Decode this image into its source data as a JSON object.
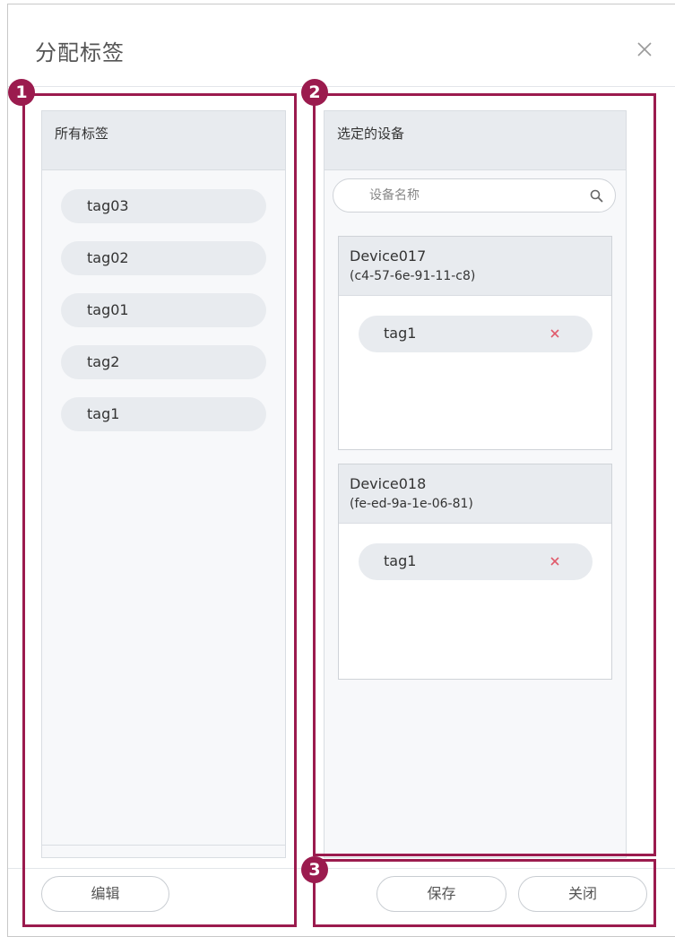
{
  "dialog": {
    "title": "分配标签",
    "close_icon": "close-icon"
  },
  "all_tags": {
    "title": "所有标签",
    "tags": [
      "tag03",
      "tag02",
      "tag01",
      "tag2",
      "tag1"
    ]
  },
  "selected_devices": {
    "title": "选定的设备",
    "search": {
      "placeholder": "设备名称",
      "value": "",
      "icon": "search-icon"
    },
    "devices": [
      {
        "name": "Device017",
        "mac": "(c4-57-6e-91-11-c8)",
        "tags": [
          "tag1"
        ]
      },
      {
        "name": "Device018",
        "mac": "(fe-ed-9a-1e-06-81)",
        "tags": [
          "tag1"
        ]
      }
    ]
  },
  "buttons": {
    "edit": "编辑",
    "save": "保存",
    "close": "关闭"
  },
  "annotations": [
    "1",
    "2",
    "3"
  ],
  "colors": {
    "annotation": "#9b1b4e",
    "panel_header": "#e8ebef",
    "remove_icon": "#e05a6b"
  }
}
